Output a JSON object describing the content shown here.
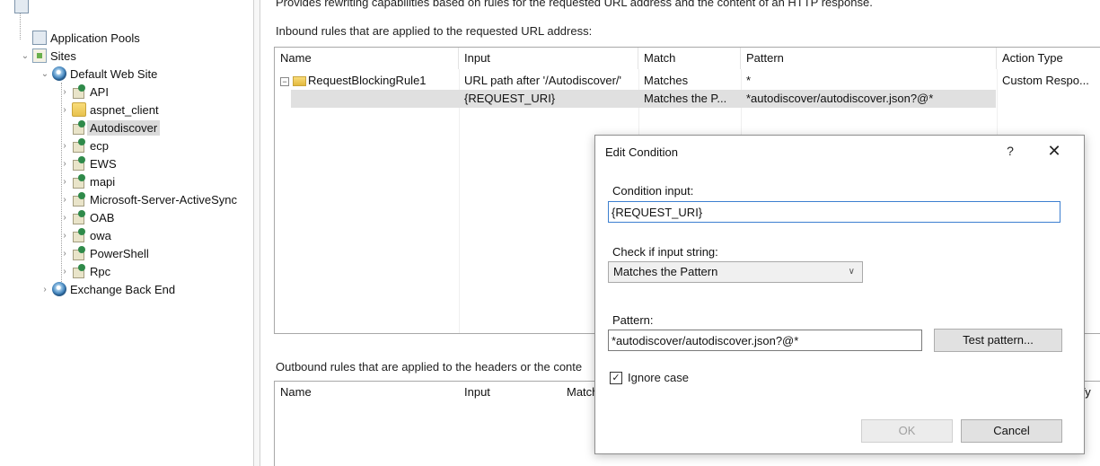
{
  "description": "Provides rewriting capabilities based on rules for the requested URL address and the content of an HTTP response.",
  "tree": {
    "items": [
      {
        "label": "Application Pools",
        "icon": "app-pools-icon",
        "indent": 0
      },
      {
        "label": "Sites",
        "icon": "sites-icon",
        "indent": 0,
        "expanded": true
      },
      {
        "label": "Default Web Site",
        "icon": "globe-icon",
        "indent": 1,
        "expanded": true
      },
      {
        "label": "API",
        "icon": "web-app-icon",
        "indent": 2
      },
      {
        "label": "aspnet_client",
        "icon": "folder-icon",
        "indent": 2
      },
      {
        "label": "Autodiscover",
        "icon": "web-app-icon",
        "indent": 2,
        "selected": true
      },
      {
        "label": "ecp",
        "icon": "web-app-icon",
        "indent": 2
      },
      {
        "label": "EWS",
        "icon": "web-app-icon",
        "indent": 2
      },
      {
        "label": "mapi",
        "icon": "web-app-icon",
        "indent": 2
      },
      {
        "label": "Microsoft-Server-ActiveSync",
        "icon": "web-app-icon",
        "indent": 2
      },
      {
        "label": "OAB",
        "icon": "web-app-icon",
        "indent": 2
      },
      {
        "label": "owa",
        "icon": "web-app-icon",
        "indent": 2
      },
      {
        "label": "PowerShell",
        "icon": "web-app-icon",
        "indent": 2
      },
      {
        "label": "Rpc",
        "icon": "web-app-icon",
        "indent": 2
      },
      {
        "label": "Exchange Back End",
        "icon": "globe-icon",
        "indent": 1
      }
    ]
  },
  "inbound": {
    "label": "Inbound rules that are applied to the requested URL address:",
    "columns": [
      "Name",
      "Input",
      "Match",
      "Pattern",
      "Action Type"
    ],
    "rows": [
      {
        "name": "RequestBlockingRule1",
        "input": "URL path after '/Autodiscover/'",
        "match": "Matches",
        "pattern": "*",
        "action": "Custom Respo..."
      },
      {
        "name": "",
        "input": "{REQUEST_URI}",
        "match": "Matches the P...",
        "pattern": "*autodiscover/autodiscover.json?@*",
        "action": ""
      }
    ]
  },
  "outbound": {
    "label": "Outbound rules that are applied to the headers or the conte",
    "columns": [
      "Name",
      "Input",
      "Match",
      "Ty"
    ]
  },
  "dialog": {
    "title": "Edit Condition",
    "help": "?",
    "close": "✕",
    "condition_input_label": "Condition input:",
    "condition_input_value": "{REQUEST_URI}",
    "check_label": "Check if input string:",
    "check_value": "Matches the Pattern",
    "pattern_label": "Pattern:",
    "pattern_value": "*autodiscover/autodiscover.json?@*",
    "test_button": "Test pattern...",
    "ignore_case_label": "Ignore case",
    "ignore_case_checked": true,
    "ok_button": "OK",
    "cancel_button": "Cancel"
  }
}
